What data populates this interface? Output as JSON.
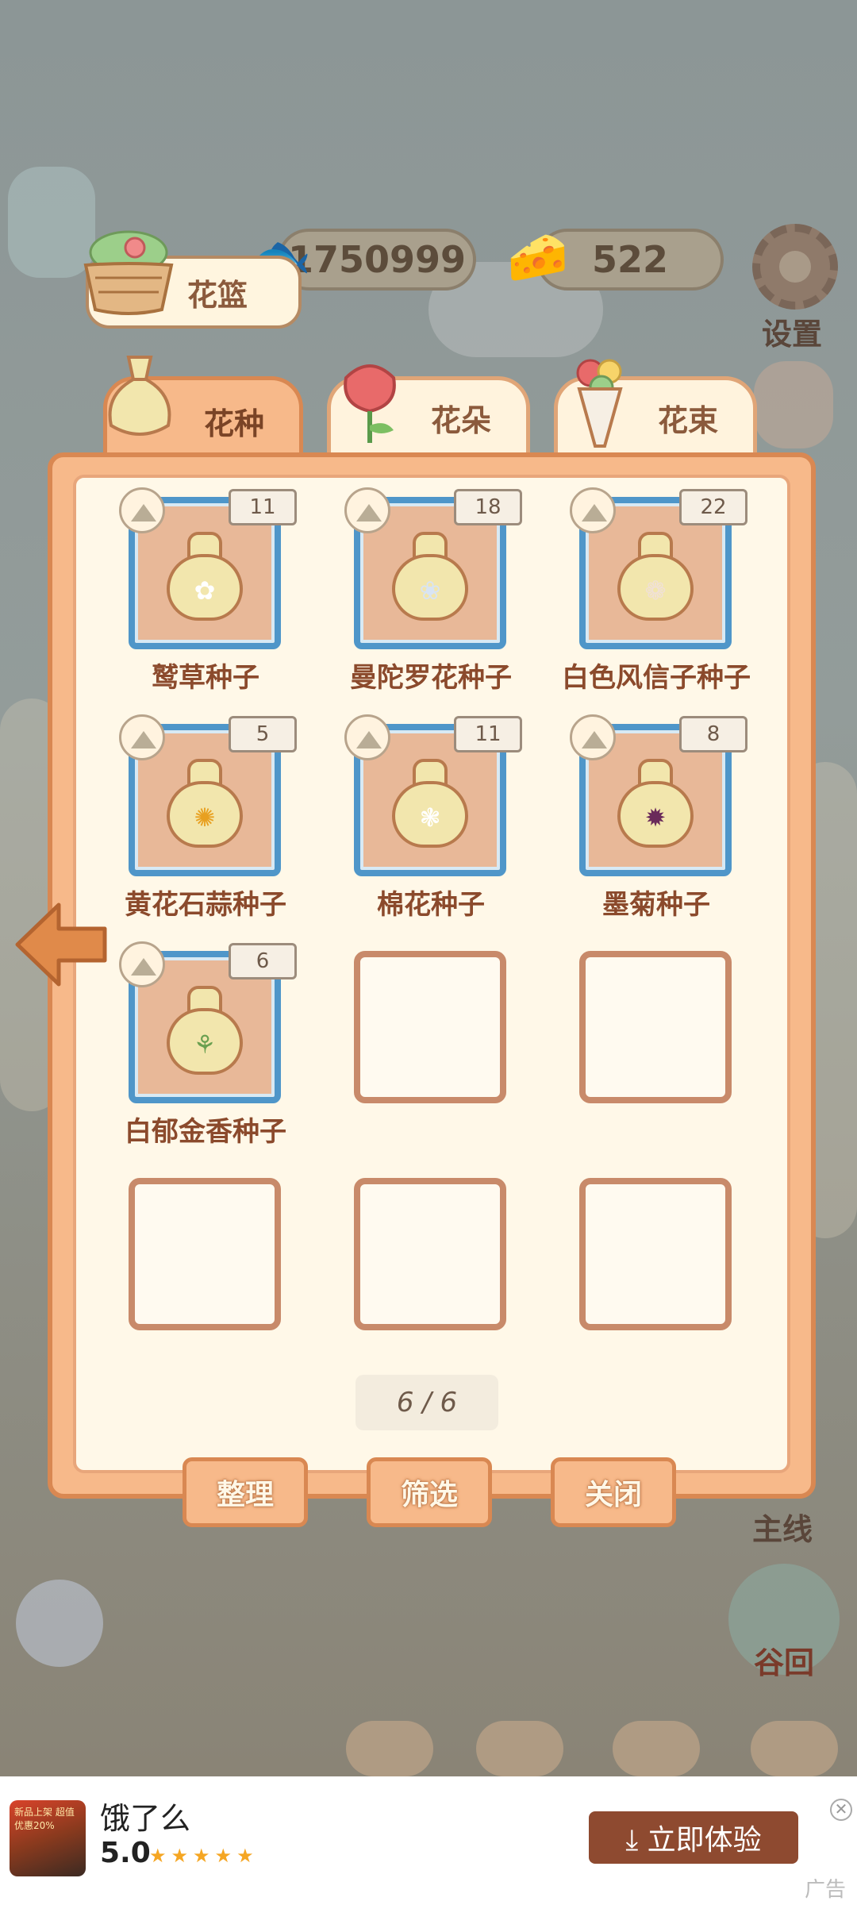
{
  "currencies": {
    "fish_value": "1750999",
    "cheese_value": "522"
  },
  "side_menu": {
    "settings_label": "设置",
    "mainline_label": "主线",
    "home_label": "谷回"
  },
  "basket": {
    "title": "花篮"
  },
  "tabs": [
    {
      "label": "花种",
      "icon": "seed-bag-icon",
      "active": true
    },
    {
      "label": "花朵",
      "icon": "rose-icon",
      "active": false
    },
    {
      "label": "花束",
      "icon": "bouquet-icon",
      "active": false
    }
  ],
  "items": [
    {
      "name": "鹫草种子",
      "count": "11",
      "flower": "✿"
    },
    {
      "name": "曼陀罗花种子",
      "count": "18",
      "flower": "❀"
    },
    {
      "name": "白色风信子种子",
      "count": "22",
      "flower": "❁"
    },
    {
      "name": "黄花石蒜种子",
      "count": "5",
      "flower": "✺"
    },
    {
      "name": "棉花种子",
      "count": "11",
      "flower": "❃"
    },
    {
      "name": "墨菊种子",
      "count": "8",
      "flower": "✹"
    },
    {
      "name": "白郁金香种子",
      "count": "6",
      "flower": "⚘"
    }
  ],
  "page_indicator": "6 / 6",
  "buttons": {
    "sort": "整理",
    "filter": "筛选",
    "close": "关闭"
  },
  "ad": {
    "title": "饿了么",
    "rating": "5.0",
    "stars": "★★★★★",
    "cta": "⤓ 立即体验",
    "label": "广告",
    "close": "✕",
    "thumb_text": "新品上架 超值优惠20%"
  },
  "colors": {
    "panel_orange": "#f7b98a",
    "slot_blue": "#4f96c9",
    "text_brown": "#8b4a2c",
    "ad_button": "#8e4a30"
  }
}
